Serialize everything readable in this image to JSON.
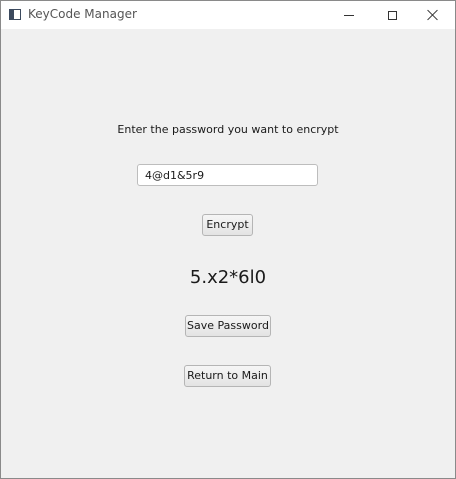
{
  "window": {
    "title": "KeyCode Manager",
    "app_icon": "window-app-icon",
    "controls": {
      "minimize_icon": "minimize-icon",
      "maximize_icon": "maximize-icon",
      "close_icon": "close-icon"
    }
  },
  "main": {
    "prompt": "Enter the password you want to encrypt",
    "password_input": {
      "value": "4@d1&5r9"
    },
    "encrypt_label": "Encrypt",
    "encrypted_result": "5.x2*6l0",
    "save_label": "Save Password",
    "return_label": "Return to Main"
  }
}
